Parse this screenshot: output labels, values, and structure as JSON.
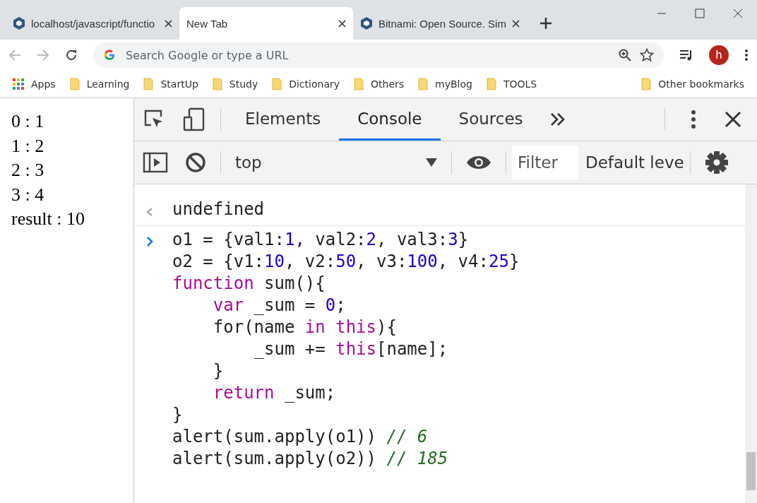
{
  "browser": {
    "tabs": [
      {
        "title": "localhost/javascript/functio",
        "selected": false,
        "kind": "site"
      },
      {
        "title": "New Tab",
        "selected": true,
        "kind": "blank"
      },
      {
        "title": "Bitnami: Open Source. Sim",
        "selected": false,
        "kind": "site"
      }
    ],
    "address": {
      "placeholder": "Search Google or type a URL"
    },
    "avatar": "h",
    "bookmarks": [
      {
        "label": "Apps",
        "kind": "apps"
      },
      {
        "label": "Learning",
        "kind": "folder"
      },
      {
        "label": "StartUp",
        "kind": "folder"
      },
      {
        "label": "Study",
        "kind": "folder"
      },
      {
        "label": "Dictionary",
        "kind": "folder"
      },
      {
        "label": "Others",
        "kind": "folder"
      },
      {
        "label": "myBlog",
        "kind": "folder"
      },
      {
        "label": "TOOLS",
        "kind": "folder"
      }
    ],
    "other_bookmarks": "Other bookmarks"
  },
  "page": {
    "lines": [
      "0 : 1",
      "1 : 2",
      "2 : 3",
      "3 : 4",
      "result : 10"
    ]
  },
  "devtools": {
    "tabs": [
      {
        "label": "Elements",
        "selected": false
      },
      {
        "label": "Console",
        "selected": true
      },
      {
        "label": "Sources",
        "selected": false
      }
    ],
    "context": "top",
    "filter": {
      "placeholder": "Filter"
    },
    "levels": "Default leve",
    "console": [
      {
        "kind": "result",
        "text": "undefined"
      },
      {
        "kind": "input",
        "lines": [
          [
            {
              "kind": "plain",
              "text": "o1 = {val1:"
            },
            {
              "kind": "number",
              "text": "1"
            },
            {
              "kind": "plain",
              "text": ", val2:"
            },
            {
              "kind": "number",
              "text": "2"
            },
            {
              "kind": "plain",
              "text": ", val3:"
            },
            {
              "kind": "number",
              "text": "3"
            },
            {
              "kind": "plain",
              "text": "}"
            }
          ],
          [
            {
              "kind": "plain",
              "text": "o2 = {v1:"
            },
            {
              "kind": "number",
              "text": "10"
            },
            {
              "kind": "plain",
              "text": ", v2:"
            },
            {
              "kind": "number",
              "text": "50"
            },
            {
              "kind": "plain",
              "text": ", v3:"
            },
            {
              "kind": "number",
              "text": "100"
            },
            {
              "kind": "plain",
              "text": ", v4:"
            },
            {
              "kind": "number",
              "text": "25"
            },
            {
              "kind": "plain",
              "text": "}"
            }
          ],
          [
            {
              "kind": "keyword",
              "text": "function"
            },
            {
              "kind": "plain",
              "text": " sum(){"
            }
          ],
          [
            {
              "kind": "keyword",
              "text": "    var"
            },
            {
              "kind": "plain",
              "text": " _sum = "
            },
            {
              "kind": "number",
              "text": "0"
            },
            {
              "kind": "plain",
              "text": ";"
            }
          ],
          [
            {
              "kind": "plain",
              "text": "    for(name "
            },
            {
              "kind": "keyword",
              "text": "in"
            },
            {
              "kind": "keyword",
              "text": " this"
            },
            {
              "kind": "plain",
              "text": "){"
            }
          ],
          [
            {
              "kind": "plain",
              "text": "        _sum += "
            },
            {
              "kind": "keyword",
              "text": "this"
            },
            {
              "kind": "plain",
              "text": "[name];"
            }
          ],
          [
            {
              "kind": "plain",
              "text": "    }"
            }
          ],
          [
            {
              "kind": "keyword",
              "text": "    return"
            },
            {
              "kind": "plain",
              "text": " _sum;"
            }
          ],
          [
            {
              "kind": "plain",
              "text": "}"
            }
          ],
          [
            {
              "kind": "plain",
              "text": "alert(sum.apply(o1)) "
            },
            {
              "kind": "comment",
              "text": "// 6"
            }
          ],
          [
            {
              "kind": "plain",
              "text": "alert(sum.apply(o2)) "
            },
            {
              "kind": "comment",
              "text": "// 185"
            }
          ]
        ]
      }
    ]
  }
}
